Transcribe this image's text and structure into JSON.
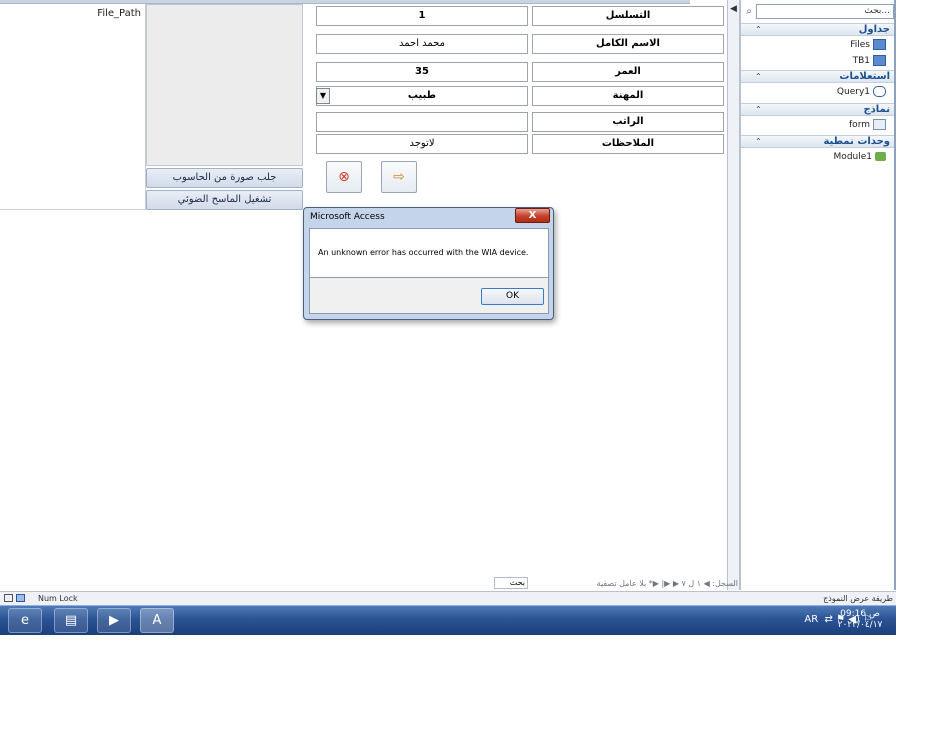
{
  "left_panel": {
    "file_path_label": "File_Path",
    "get_image_button": "جلب صورة من الحاسوب",
    "scanner_button": "تشغيل الماسح الضوئي"
  },
  "form": {
    "fields": [
      {
        "label": "التسلسل",
        "value": "1"
      },
      {
        "label": "الاسم الكامل",
        "value": "محمد احمد"
      },
      {
        "label": "العمر",
        "value": "35"
      },
      {
        "label": "المهنة",
        "value": "طبيب"
      },
      {
        "label": "الراتب",
        "value": ""
      },
      {
        "label": "الملاحظات",
        "value": "لاتوجد"
      }
    ],
    "cancel_icon": "close-circle-icon",
    "exit_icon": "exit-door-icon"
  },
  "nav_pane": {
    "search_placeholder": "بحث...",
    "groups": [
      {
        "title": "جداول",
        "items": [
          {
            "label": "Files",
            "icon": "table-icon"
          },
          {
            "label": "TB1",
            "icon": "table-icon"
          }
        ]
      },
      {
        "title": "استعلامات",
        "items": [
          {
            "label": "Query1",
            "icon": "query-icon"
          }
        ]
      },
      {
        "title": "نماذج",
        "items": [
          {
            "label": "form",
            "icon": "form-icon"
          }
        ]
      },
      {
        "title": "وحدات نمطية",
        "items": [
          {
            "label": "Module1",
            "icon": "module-icon"
          }
        ]
      }
    ]
  },
  "record_nav": {
    "text": "السجل: ◀  ١ ل ٧  ▶ ▶|  ▶*   بلا عامل تصفية",
    "search_label": "بحث"
  },
  "status_bar": {
    "num_lock": "Num Lock",
    "view_mode": "طريقة عرض النموذج"
  },
  "taskbar": {
    "language": "AR",
    "time": "09:16 ص",
    "date": "٢٠٢٣/٠٤/١٧"
  },
  "dialog": {
    "title": "Microsoft Access",
    "message": "An unknown error has occurred with the WIA device.",
    "ok_label": "OK",
    "close_label": "X"
  },
  "colors": {
    "accent": "#2c5395",
    "nav_heading": "#1d4f91",
    "dialog_frame": "#c4d4ea"
  }
}
